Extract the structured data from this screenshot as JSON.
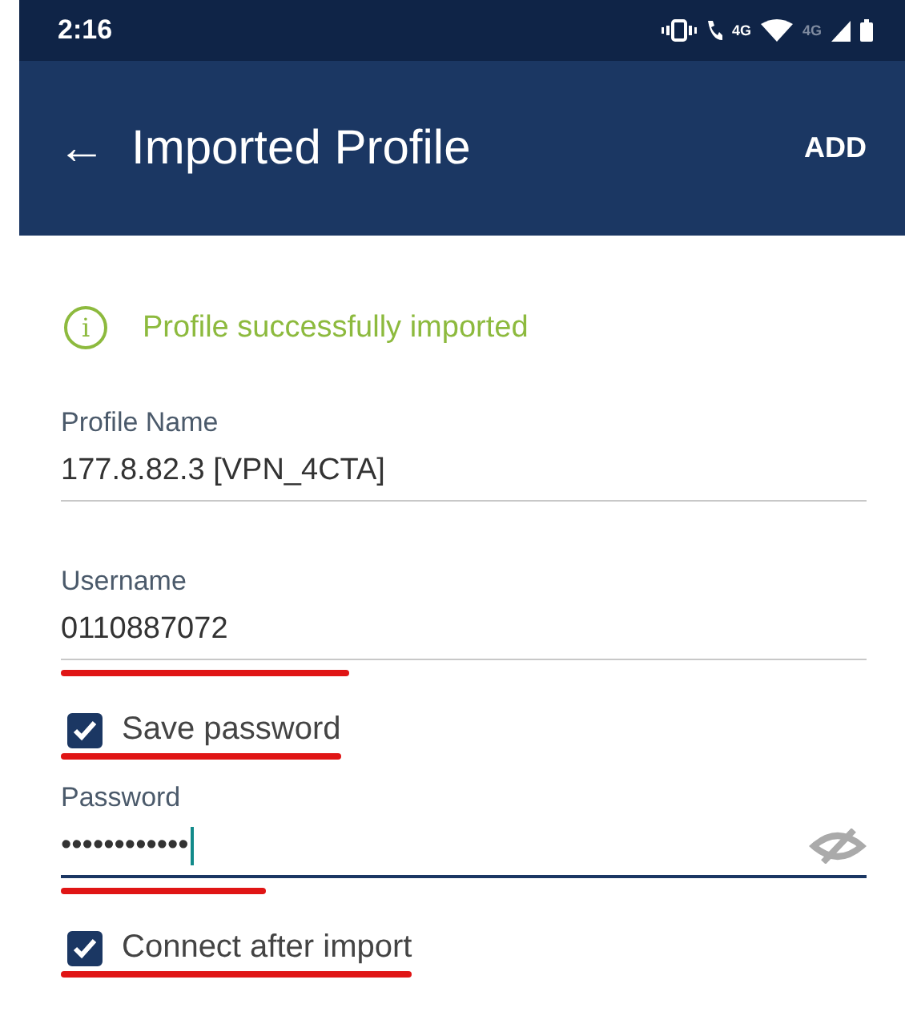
{
  "status_bar": {
    "time": "2:16",
    "call_network": "4G",
    "mobile_network": "4G"
  },
  "app_bar": {
    "back": "←",
    "title": "Imported Profile",
    "action": "ADD"
  },
  "notice": {
    "icon": "i",
    "text": "Profile successfully imported"
  },
  "form": [
    {
      "kind": "field",
      "label": "Profile Name",
      "value": "177.8.82.3 [VPN_4CTA]",
      "focused": false,
      "highlighted": false
    },
    {
      "kind": "field",
      "label": "Username",
      "value": "0110887072",
      "focused": false,
      "highlighted": true
    },
    {
      "kind": "checkbox",
      "label": "Save password",
      "checked": true,
      "highlighted": true
    },
    {
      "kind": "password",
      "label": "Password",
      "value": "••••••••••••",
      "focused": true,
      "highlighted": true
    },
    {
      "kind": "checkbox",
      "label": "Connect after import",
      "checked": true,
      "highlighted": true
    }
  ]
}
